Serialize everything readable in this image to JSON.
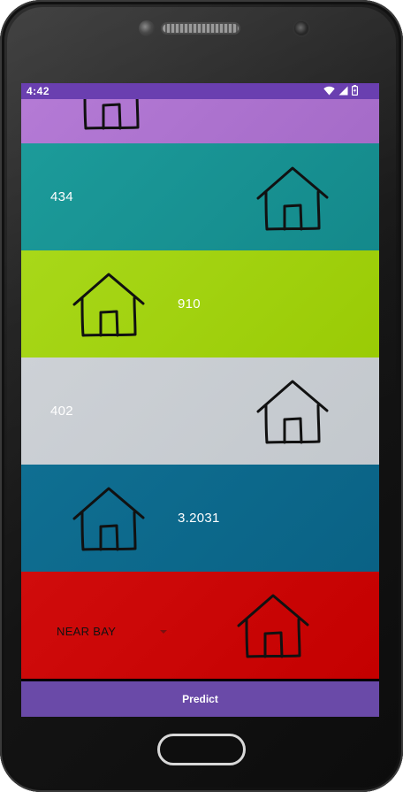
{
  "status_bar": {
    "time": "4:42",
    "icons": [
      "wifi-icon",
      "cellular-signal-icon",
      "battery-charging-icon"
    ],
    "background": "#6a3fb0"
  },
  "rows": [
    {
      "color": "#ad72cf",
      "icon": "house-icon"
    },
    {
      "color": "#18928f",
      "icon": "house-icon",
      "value": "434"
    },
    {
      "color": "#a1d010",
      "icon": "house-icon",
      "value": "910"
    },
    {
      "color": "#c8ccd1",
      "icon": "house-icon",
      "value": "402"
    },
    {
      "color": "#0c6a8c",
      "icon": "house-icon",
      "value": "3.2031"
    },
    {
      "color": "#c90606",
      "icon": "house-icon",
      "dropdown": {
        "selected": "NEAR BAY"
      }
    }
  ],
  "predict": {
    "label": "Predict",
    "color": "#6a4aa8"
  }
}
